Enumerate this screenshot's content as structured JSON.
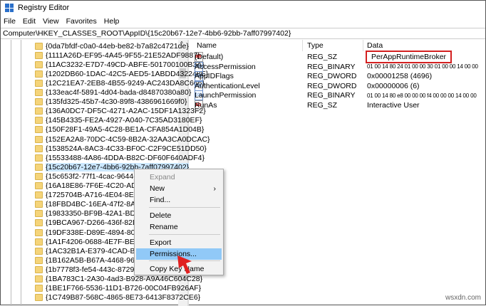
{
  "window": {
    "title": "Registry Editor"
  },
  "menu": [
    "File",
    "Edit",
    "View",
    "Favorites",
    "Help"
  ],
  "address": "Computer\\HKEY_CLASSES_ROOT\\AppID\\{15c20b67-12e7-4bb6-92bb-7aff07997402}",
  "tree": {
    "selected_index": 13,
    "items": [
      "{0da7bfdf-c0a0-44eb-be82-b7a82c4721de}",
      "{1111A26D-EF95-4A45-9F55-21E52ADF9887}",
      "{11AC3232-E7D7-49CD-ABFE-501700100B3A}",
      "{1202DB60-1DAC-42C5-AED5-1ABDD432248E}",
      "{12C21EA7-2EB8-4B55-9249-AC243DA8C666}",
      "{133eac4f-5891-4d04-bada-d84870380a80}",
      "{135fd325-45b7-4c30-89f8-4386961669f0}",
      "{136A0DC7-DF5C-4271-A2AC-15DF1A1323F2}",
      "{145B4335-FE2A-4927-A040-7C35AD3180EF}",
      "{150F28F1-49A5-4C28-BE1A-CFA854A1D04B}",
      "{152EA2A8-70DC-4C59-8B2A-32AA3CA0DCAC}",
      "{1538524A-8AC3-4C33-BF0C-C2F9CE51DD50}",
      "{15533488-4A86-4DDA-B82C-DF60F640ADF4}",
      "{15c20b67-12e7-4bb6-92bb-7aff07997402}",
      "{15c653f2-77f1-4cac-9644-656",
      "{16A18E86-7F6E-4C20-AD89-4",
      "{1725704B-A716-4E04-8EF6-87",
      "{18FBD4BC-16EA-47f2-8AD0-8",
      "{19833350-BF9B-42A1-BDF0-B",
      "{19BCA967-D266-436f-82D4-C",
      "{19DF338E-D89E-4894-80D0-9F",
      "{1A1F4206-0688-4E7F-BE03-D8",
      "{1AC32B1A-E379-4CAD-B655-",
      "{1B162A5B-B67A-4468-9613-C",
      "{1b7778f3-fe54-443c-8729-1e7",
      "{1BA783C1-2A30-4ad3-B928-A9A46C604C28}",
      "{1BE1F766-5536-11D1-B726-00C04FB926AF}",
      "{1C749B87-568C-4865-8E73-6413F8372CE6}"
    ]
  },
  "values": {
    "columns": [
      "Name",
      "Type",
      "Data"
    ],
    "rows": [
      {
        "icon": "string-value-icon",
        "name": "(Default)",
        "type": "REG_SZ",
        "data": "PerAppRuntimeBroker"
      },
      {
        "icon": "binary-value-icon",
        "name": "AccessPermission",
        "type": "REG_BINARY",
        "data": "01 00 14 80 24 01 00 00 30 01 00 00 14 00 00"
      },
      {
        "icon": "binary-value-icon",
        "name": "AppIDFlags",
        "type": "REG_DWORD",
        "data": "0x00001258 (4696)"
      },
      {
        "icon": "binary-value-icon",
        "name": "AuthenticationLevel",
        "type": "REG_DWORD",
        "data": "0x00000006 (6)"
      },
      {
        "icon": "binary-value-icon",
        "name": "LaunchPermission",
        "type": "REG_BINARY",
        "data": "01 00 14 80 e8 00 00 00 f4 00 00 00 14 00 00"
      },
      {
        "icon": "string-value-icon",
        "name": "RunAs",
        "type": "REG_SZ",
        "data": "Interactive User"
      }
    ]
  },
  "context_menu": {
    "items": [
      "Expand",
      "New",
      "Find...",
      "Delete",
      "Rename",
      "Export",
      "Permissions...",
      "Copy Key Name"
    ],
    "highlighted": "Permissions...",
    "disabled": [
      "Expand"
    ]
  },
  "watermark": "wsxdn.com",
  "colors": {
    "highlight": "#91c9f7",
    "callout": "#d32020",
    "folder": "#f5d479"
  }
}
